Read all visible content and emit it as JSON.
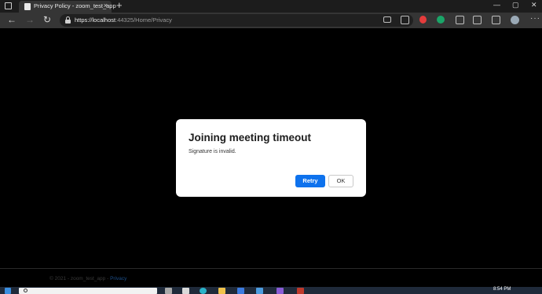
{
  "browser": {
    "tab_title": "Privacy Policy - zoom_test_app",
    "tab_close": "×",
    "new_tab": "+",
    "url_host": "https://localhost",
    "url_rest": ":44325/Home/Privacy",
    "menu_dots": "···"
  },
  "dialog": {
    "title": "Joining meeting timeout",
    "message": "Signature is invalid.",
    "retry_label": "Retry",
    "ok_label": "OK"
  },
  "footer": {
    "text": "© 2021 - zoom_test_app - ",
    "link": "Privacy"
  },
  "taskbar": {
    "time": "8:54 PM"
  },
  "colors": {
    "accent": "#0e72ed",
    "page_bg": "#000000"
  }
}
